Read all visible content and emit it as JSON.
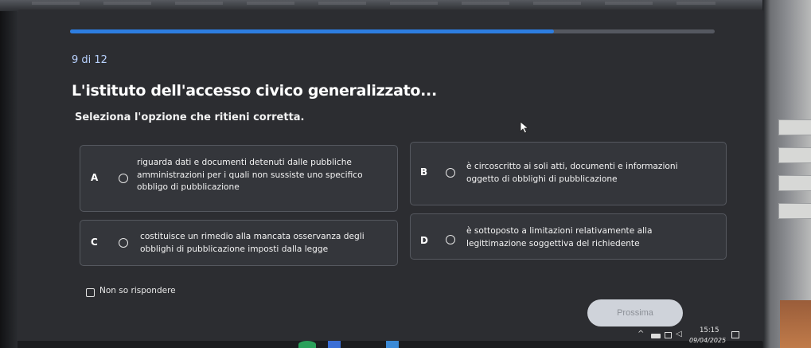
{
  "progress": {
    "fraction": 0.75,
    "counter_text": "9 di 12"
  },
  "question": {
    "title": "L'istituto dell'accesso civico generalizzato...",
    "instruction": "Seleziona l'opzione che ritieni corretta."
  },
  "options": [
    {
      "letter": "A",
      "lines": [
        "riguarda dati e documenti detenuti dalle pubbliche",
        "amministrazioni per i quali non sussiste uno specifico",
        "obbligo di pubblicazione"
      ]
    },
    {
      "letter": "B",
      "lines": [
        "è circoscritto ai soli atti, documenti e informazioni",
        "oggetto di obblighi di pubblicazione"
      ]
    },
    {
      "letter": "C",
      "lines": [
        "costituisce un rimedio alla mancata osservanza degli",
        "obblighi di pubblicazione imposti dalla legge"
      ]
    },
    {
      "letter": "D",
      "lines": [
        "è sottoposto a limitazioni relativamente alla",
        "legittimazione soggettiva del richiedente"
      ]
    }
  ],
  "no_answer": {
    "label": "Non so rispondere",
    "checked": false
  },
  "next_button": {
    "label": "Prossima",
    "enabled": false
  },
  "taskbar": {
    "time": "15:15",
    "date": "09/04/2025",
    "tray_icons": [
      "chevron-up-icon",
      "battery-icon",
      "network-icon",
      "volume-icon",
      "notification-icon"
    ]
  },
  "colors": {
    "accent": "#2d7de0",
    "background": "#2c2d31",
    "option_bg": "#34363b",
    "counter": "#b9d2ff"
  }
}
